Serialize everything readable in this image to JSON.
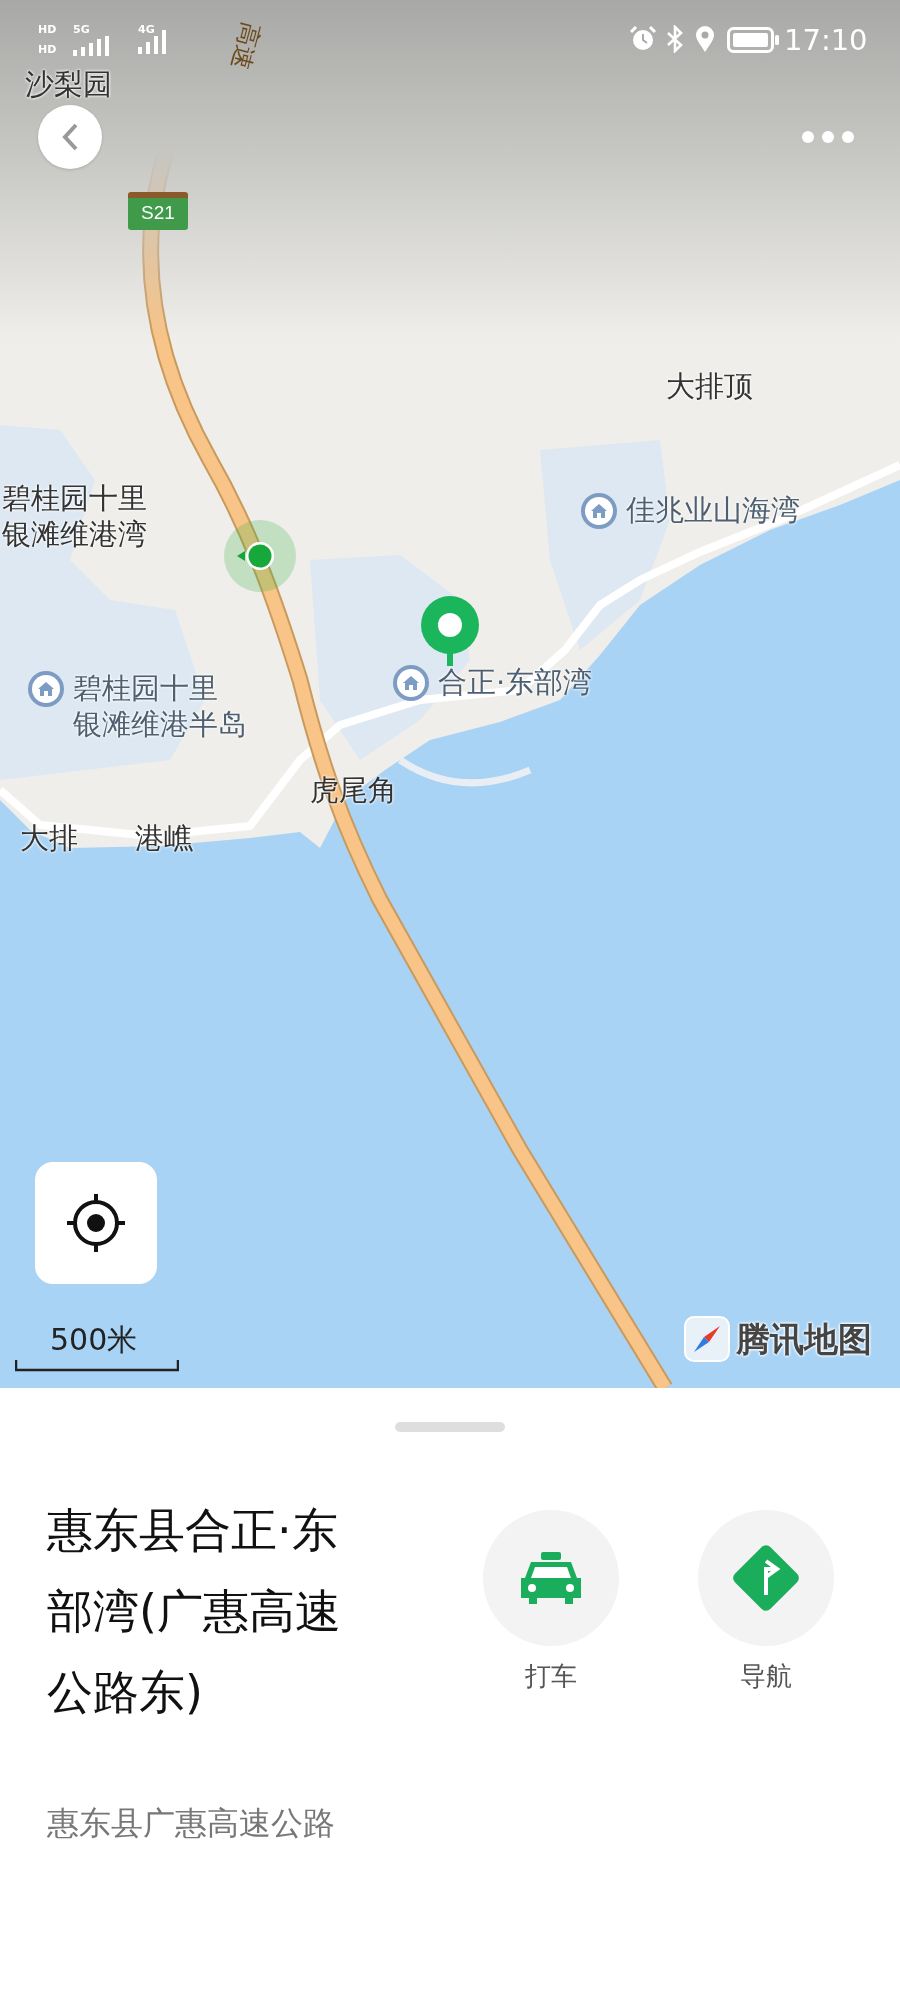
{
  "status_bar": {
    "sim_badges": [
      "HD",
      "HD"
    ],
    "networks": [
      "5G",
      "4G"
    ],
    "time": "17:10"
  },
  "map": {
    "road_label": "高速",
    "road_shield": "S21",
    "labels": [
      {
        "kind": "place",
        "lines": [
          "沙梨园"
        ]
      },
      {
        "kind": "place",
        "lines": [
          "大排顶"
        ]
      },
      {
        "kind": "poi",
        "lines": [
          "佳兆业山海湾"
        ]
      },
      {
        "kind": "place",
        "lines": [
          "碧桂园十里",
          "银滩维港湾"
        ]
      },
      {
        "kind": "poi",
        "lines": [
          "碧桂园十里",
          "银滩维港半岛"
        ]
      },
      {
        "kind": "poi",
        "lines": [
          "合正·东部湾"
        ]
      },
      {
        "kind": "place",
        "lines": [
          "虎尾角"
        ]
      },
      {
        "kind": "place",
        "lines": [
          "大排"
        ]
      },
      {
        "kind": "place",
        "lines": [
          "港嶕"
        ]
      }
    ],
    "scale": "500米",
    "logo": "腾讯地图"
  },
  "panel": {
    "title": "惠东县合正·东部湾(广惠高速公路东)",
    "actions": [
      {
        "kind": "taxi",
        "label": "打车"
      },
      {
        "kind": "navigate",
        "label": "导航"
      }
    ],
    "address": "惠东县广惠高速公路"
  }
}
